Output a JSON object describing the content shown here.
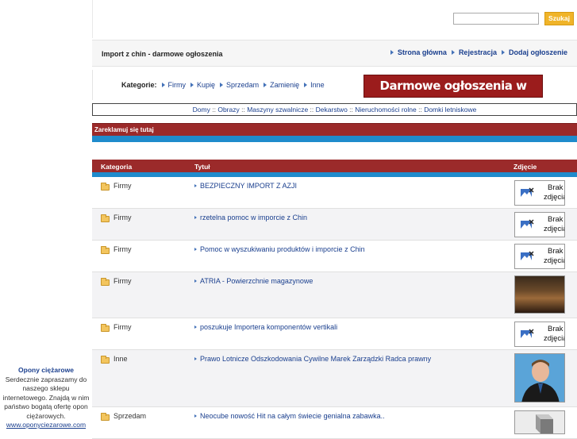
{
  "left_ad": {
    "title": "Opony ciężarowe",
    "body": "Serdecznie zapraszamy do naszego sklepu internetowego. Znajdą w nim państwo bogatą ofertę opon ciężarowych.",
    "url": "www.oponyciezarowe.com"
  },
  "search": {
    "value": "",
    "button_label": "Szukaj"
  },
  "header": {
    "site_title": "Import z chin - darmowe ogłoszenia",
    "nav": [
      "Strona główna",
      "Rejestracja",
      "Dodaj ogłoszenie"
    ]
  },
  "categories": {
    "label": "Kategorie:",
    "items": [
      "Firmy",
      "Kupię",
      "Sprzedam",
      "Zamienię",
      "Inne"
    ],
    "banner": "Darmowe ogłoszenia w sieci !!"
  },
  "sub_links": [
    "Domy",
    "Obrazy",
    "Maszyny szwalnicze",
    "Dekarstwo",
    "Nieruchomości rolne",
    "Domki letniskowe"
  ],
  "sub_links_sep": " :: ",
  "ad_bar_label": "Zareklamuj się tutaj",
  "table": {
    "headers": [
      "Kategoria",
      "Tytuł",
      "Zdjęcie"
    ],
    "no_image_label_1": "Brak",
    "no_image_label_2": "zdjęcia",
    "rows": [
      {
        "category": "Firmy",
        "title": "BEZPIECZNY IMPORT Z AZJI",
        "image": "none"
      },
      {
        "category": "Firmy",
        "title": "rzetelna pomoc w imporcie z Chin",
        "image": "none"
      },
      {
        "category": "Firmy",
        "title": "Pomoc w wyszukiwaniu produktów i imporcie z Chin",
        "image": "none"
      },
      {
        "category": "Firmy",
        "title": "ATRIA - Powierzchnie magazynowe",
        "image": "warehouse-photo"
      },
      {
        "category": "Firmy",
        "title": "poszukuje Importera komponentów vertikali",
        "image": "none"
      },
      {
        "category": "Inne",
        "title": "Prawo Lotnicze Odszkodowania Cywilne Marek Zarządzki Radca prawny",
        "image": "person-photo"
      },
      {
        "category": "Sprzedam",
        "title": "Neocube nowość Hit na całym świecie genialna zabawka..",
        "image": "cube-photo"
      }
    ]
  },
  "colors": {
    "accent_red": "#9b2a2a",
    "accent_blue": "#1f8bcc",
    "link": "#1a3f8e",
    "button": "#f0b429"
  }
}
